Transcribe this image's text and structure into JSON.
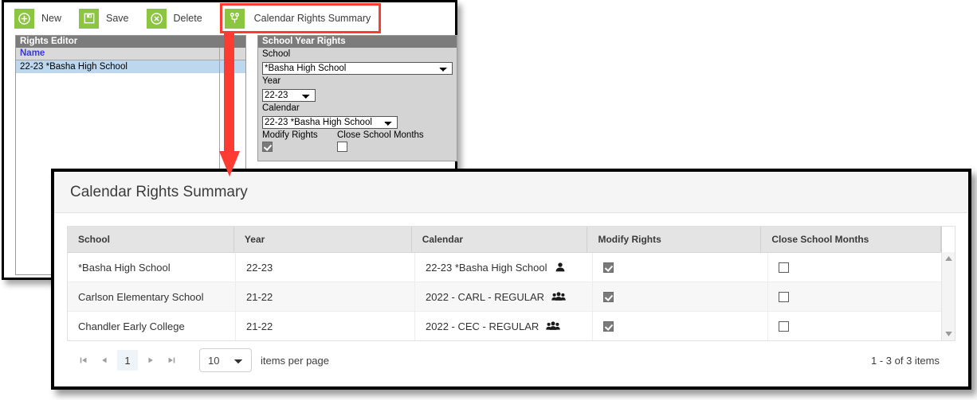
{
  "toolbar": {
    "buttons": [
      {
        "label": "New",
        "icon": "plus-circle-icon"
      },
      {
        "label": "Save",
        "icon": "floppy-disk-icon"
      },
      {
        "label": "Delete",
        "icon": "x-circle-icon"
      },
      {
        "label": "Calendar Rights Summary",
        "icon": "branch-icon"
      }
    ],
    "icon_color": "#8cc640",
    "highlight_color": "#fc3b33"
  },
  "rights_editor": {
    "caption": "Rights Editor",
    "column_header": "Name",
    "rows": [
      {
        "name": "22-23 *Basha High School"
      }
    ]
  },
  "school_year_rights": {
    "caption": "School Year Rights",
    "fields": {
      "school_label": "School",
      "school_value": "*Basha High School",
      "year_label": "Year",
      "year_value": "22-23",
      "calendar_label": "Calendar",
      "calendar_value": "22-23 *Basha High School",
      "modify_rights_label": "Modify Rights",
      "modify_rights_checked": true,
      "close_school_months_label": "Close School Months",
      "close_school_months_checked": false
    }
  },
  "modal": {
    "title": "Calendar Rights Summary",
    "grid": {
      "columns": [
        "School",
        "Year",
        "Calendar",
        "Modify Rights",
        "Close School Months"
      ],
      "rows": [
        {
          "school": "*Basha High School",
          "year": "22-23",
          "calendar": "22-23 *Basha High School",
          "calendar_icon": "single-person-icon",
          "modify_rights": true,
          "close_school_months": false
        },
        {
          "school": "Carlson Elementary School",
          "year": "21-22",
          "calendar": "2022 - CARL - REGULAR",
          "calendar_icon": "group-people-icon",
          "modify_rights": true,
          "close_school_months": false
        },
        {
          "school": "Chandler Early College",
          "year": "21-22",
          "calendar": "2022 - CEC - REGULAR",
          "calendar_icon": "group-people-icon",
          "modify_rights": true,
          "close_school_months": false
        }
      ]
    },
    "pager": {
      "first_label": "⏮",
      "prev_label": "◀",
      "current_page": "1",
      "next_label": "▶",
      "last_label": "⏭",
      "page_size": "10",
      "items_per_page_label": "items per page",
      "item_count": "1 - 3 of 3 items"
    }
  }
}
